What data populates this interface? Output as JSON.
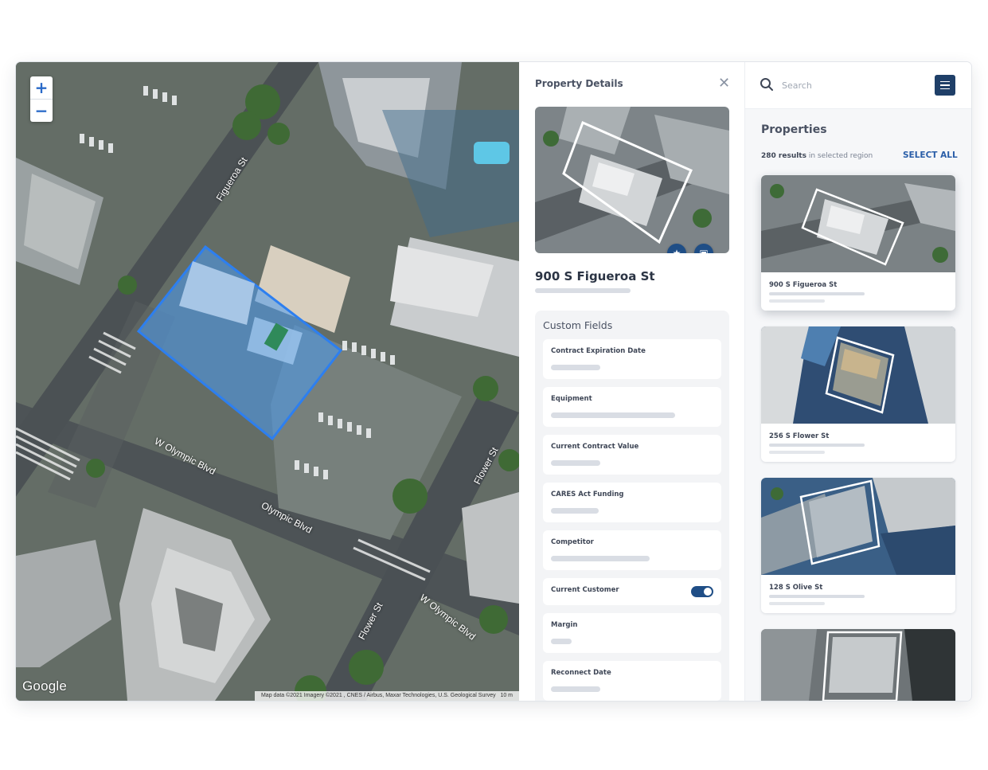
{
  "map": {
    "zoom_in": "+",
    "zoom_out": "−",
    "streets": [
      "Figueroa St",
      "W Olympic Blvd",
      "Olympic Blvd",
      "Flower St",
      "Flower St",
      "W Olympic Blvd"
    ],
    "google_logo": "Google",
    "attribution": "Map data ©2021 Imagery ©2021 , CNES / Airbus, Maxar Technologies, U.S. Geological Survey",
    "scale": "10 m"
  },
  "details": {
    "header": "Property Details",
    "close_icon": "close-icon",
    "address": "900 S Figueroa St",
    "custom_fields_title": "Custom Fields",
    "fields": [
      {
        "label": "Contract Expiration Date"
      },
      {
        "label": "Equipment"
      },
      {
        "label": "Current Contract Value"
      },
      {
        "label": "CARES Act Funding"
      },
      {
        "label": "Competitor"
      },
      {
        "label": "Current Customer",
        "toggle": true
      },
      {
        "label": "Margin"
      },
      {
        "label": "Reconnect Date"
      }
    ]
  },
  "list": {
    "search_placeholder": "Search",
    "title": "Properties",
    "count": "280 results",
    "count_suffix": "in selected region",
    "select_all": "SELECT ALL",
    "properties": [
      {
        "name": "900 S Figueroa St"
      },
      {
        "name": "256 S Flower St"
      },
      {
        "name": "128 S Olive St"
      },
      {
        "name": ""
      }
    ]
  },
  "colors": {
    "accent": "#1f4e86",
    "link": "#2a5ea8",
    "highlight": "#4a9af0"
  }
}
